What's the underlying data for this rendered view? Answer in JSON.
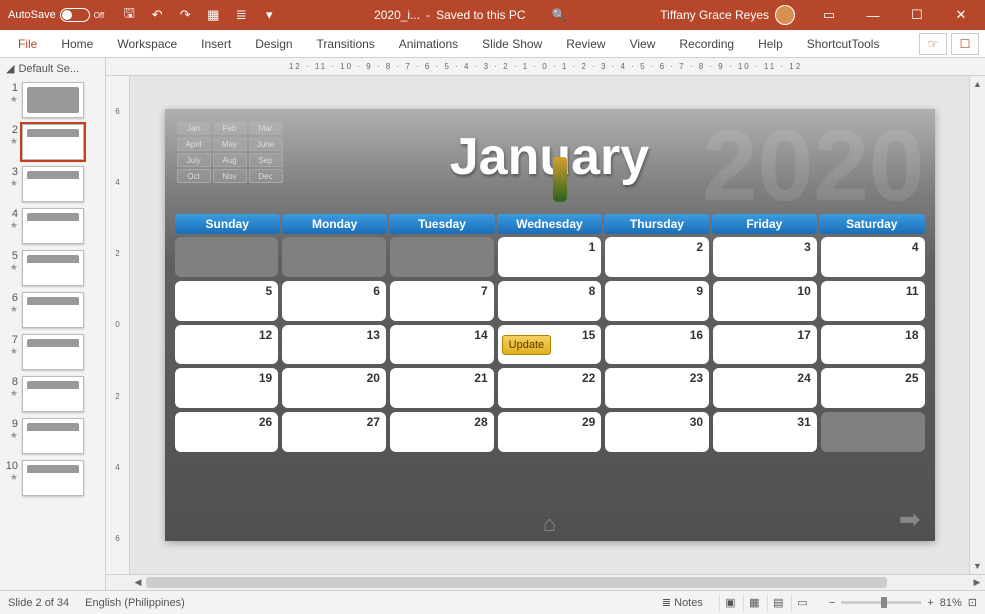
{
  "titlebar": {
    "autosave_label": "AutoSave",
    "autosave_state": "Off",
    "filename": "2020_i...",
    "save_state": "Saved to this PC",
    "user": "Tiffany Grace Reyes"
  },
  "ribbon": {
    "tabs": [
      "File",
      "Home",
      "Workspace",
      "Insert",
      "Design",
      "Transitions",
      "Animations",
      "Slide Show",
      "Review",
      "View",
      "Recording",
      "Help",
      "ShortcutTools"
    ]
  },
  "sidepanel": {
    "section": "Default Se...",
    "slides": [
      {
        "num": "1"
      },
      {
        "num": "2"
      },
      {
        "num": "3"
      },
      {
        "num": "4"
      },
      {
        "num": "5"
      },
      {
        "num": "6"
      },
      {
        "num": "7"
      },
      {
        "num": "8"
      },
      {
        "num": "9"
      },
      {
        "num": "10"
      }
    ],
    "selected": 2
  },
  "ruler_h": "12 · 11 · 10 · 9 · 8 · 7 · 6 · 5 · 4 · 3 · 2 · 1 · 0 · 1 · 2 · 3 · 4 · 5 · 6 · 7 · 8 · 9 · 10 · 11 · 12",
  "ruler_v": [
    "6",
    "4",
    "2",
    "0",
    "2",
    "4",
    "6"
  ],
  "slide": {
    "title": "January",
    "year_bg": "2020",
    "month_nav": [
      "Jan",
      "Feb",
      "Mar",
      "April",
      "May",
      "June",
      "July",
      "Aug",
      "Sep",
      "Oct",
      "Nov",
      "Dec"
    ],
    "day_headers": [
      "Sunday",
      "Monday",
      "Tuesday",
      "Wednesday",
      "Thursday",
      "Friday",
      "Saturday"
    ],
    "cells": [
      {
        "n": "",
        "empty": true
      },
      {
        "n": "",
        "empty": true
      },
      {
        "n": "",
        "empty": true
      },
      {
        "n": "1"
      },
      {
        "n": "2"
      },
      {
        "n": "3"
      },
      {
        "n": "4"
      },
      {
        "n": "5"
      },
      {
        "n": "6"
      },
      {
        "n": "7"
      },
      {
        "n": "8"
      },
      {
        "n": "9"
      },
      {
        "n": "10"
      },
      {
        "n": "11"
      },
      {
        "n": "12"
      },
      {
        "n": "13"
      },
      {
        "n": "14"
      },
      {
        "n": "15",
        "tag": "Update"
      },
      {
        "n": "16"
      },
      {
        "n": "17"
      },
      {
        "n": "18"
      },
      {
        "n": "19"
      },
      {
        "n": "20"
      },
      {
        "n": "21"
      },
      {
        "n": "22"
      },
      {
        "n": "23"
      },
      {
        "n": "24"
      },
      {
        "n": "25"
      },
      {
        "n": "26"
      },
      {
        "n": "27"
      },
      {
        "n": "28"
      },
      {
        "n": "29"
      },
      {
        "n": "30"
      },
      {
        "n": "31"
      },
      {
        "n": "",
        "empty": true
      }
    ]
  },
  "statusbar": {
    "slide_info": "Slide 2 of 34",
    "language": "English (Philippines)",
    "notes": "Notes",
    "zoom": "81%"
  }
}
